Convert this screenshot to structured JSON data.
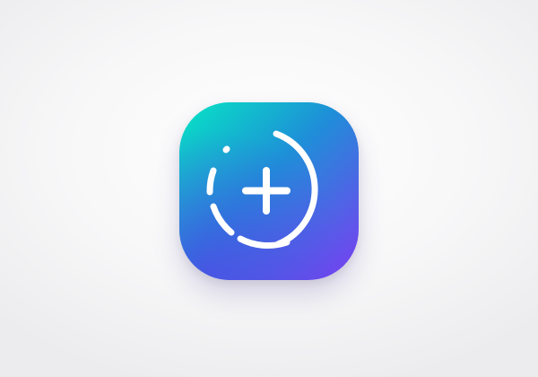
{
  "app_icon": {
    "name": "story-add-icon",
    "gradient": {
      "top_left": "#06e6c4",
      "mid": "#1e8fd8",
      "bottom_right": "#7c3cf2",
      "bottom_left": "#5a35e8"
    },
    "glyph_color": "#ffffff"
  }
}
